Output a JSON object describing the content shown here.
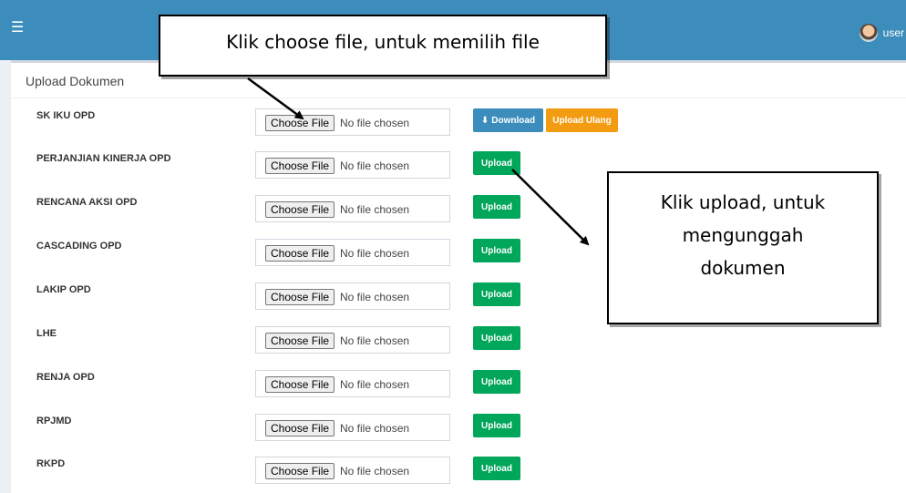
{
  "topbar": {
    "menu_icon": "hamburger-icon",
    "username": "user",
    "bg_color": "#3c8dbc"
  },
  "panel": {
    "title": "Upload Dokumen",
    "rows": [
      {
        "label": "SK IKU OPD",
        "choose": "Choose File",
        "status": "No file chosen",
        "buttons": [
          "Download",
          "Upload Ulang"
        ]
      },
      {
        "label": "PERJANJIAN KINERJA OPD",
        "choose": "Choose File",
        "status": "No file chosen",
        "buttons": [
          "Upload"
        ]
      },
      {
        "label": "RENCANA AKSI OPD",
        "choose": "Choose File",
        "status": "No file chosen",
        "buttons": [
          "Upload"
        ]
      },
      {
        "label": "CASCADING OPD",
        "choose": "Choose File",
        "status": "No file chosen",
        "buttons": [
          "Upload"
        ]
      },
      {
        "label": "LAKIP OPD",
        "choose": "Choose File",
        "status": "No file chosen",
        "buttons": [
          "Upload"
        ]
      },
      {
        "label": "LHE",
        "choose": "Choose File",
        "status": "No file chosen",
        "buttons": [
          "Upload"
        ]
      },
      {
        "label": "RENJA OPD",
        "choose": "Choose File",
        "status": "No file chosen",
        "buttons": [
          "Upload"
        ]
      },
      {
        "label": "RPJMD",
        "choose": "Choose File",
        "status": "No file chosen",
        "buttons": [
          "Upload"
        ]
      },
      {
        "label": "RKPD",
        "choose": "Choose File",
        "status": "No file chosen",
        "buttons": [
          "Upload"
        ]
      }
    ]
  },
  "colors": {
    "download": "#3c8dbc",
    "upload_ulang": "#f39c12",
    "upload": "#00a65a"
  },
  "callouts": {
    "choose_file": "Klik choose file, untuk memilih file",
    "upload": [
      "Klik upload, untuk",
      "mengunggah",
      "dokumen"
    ]
  }
}
